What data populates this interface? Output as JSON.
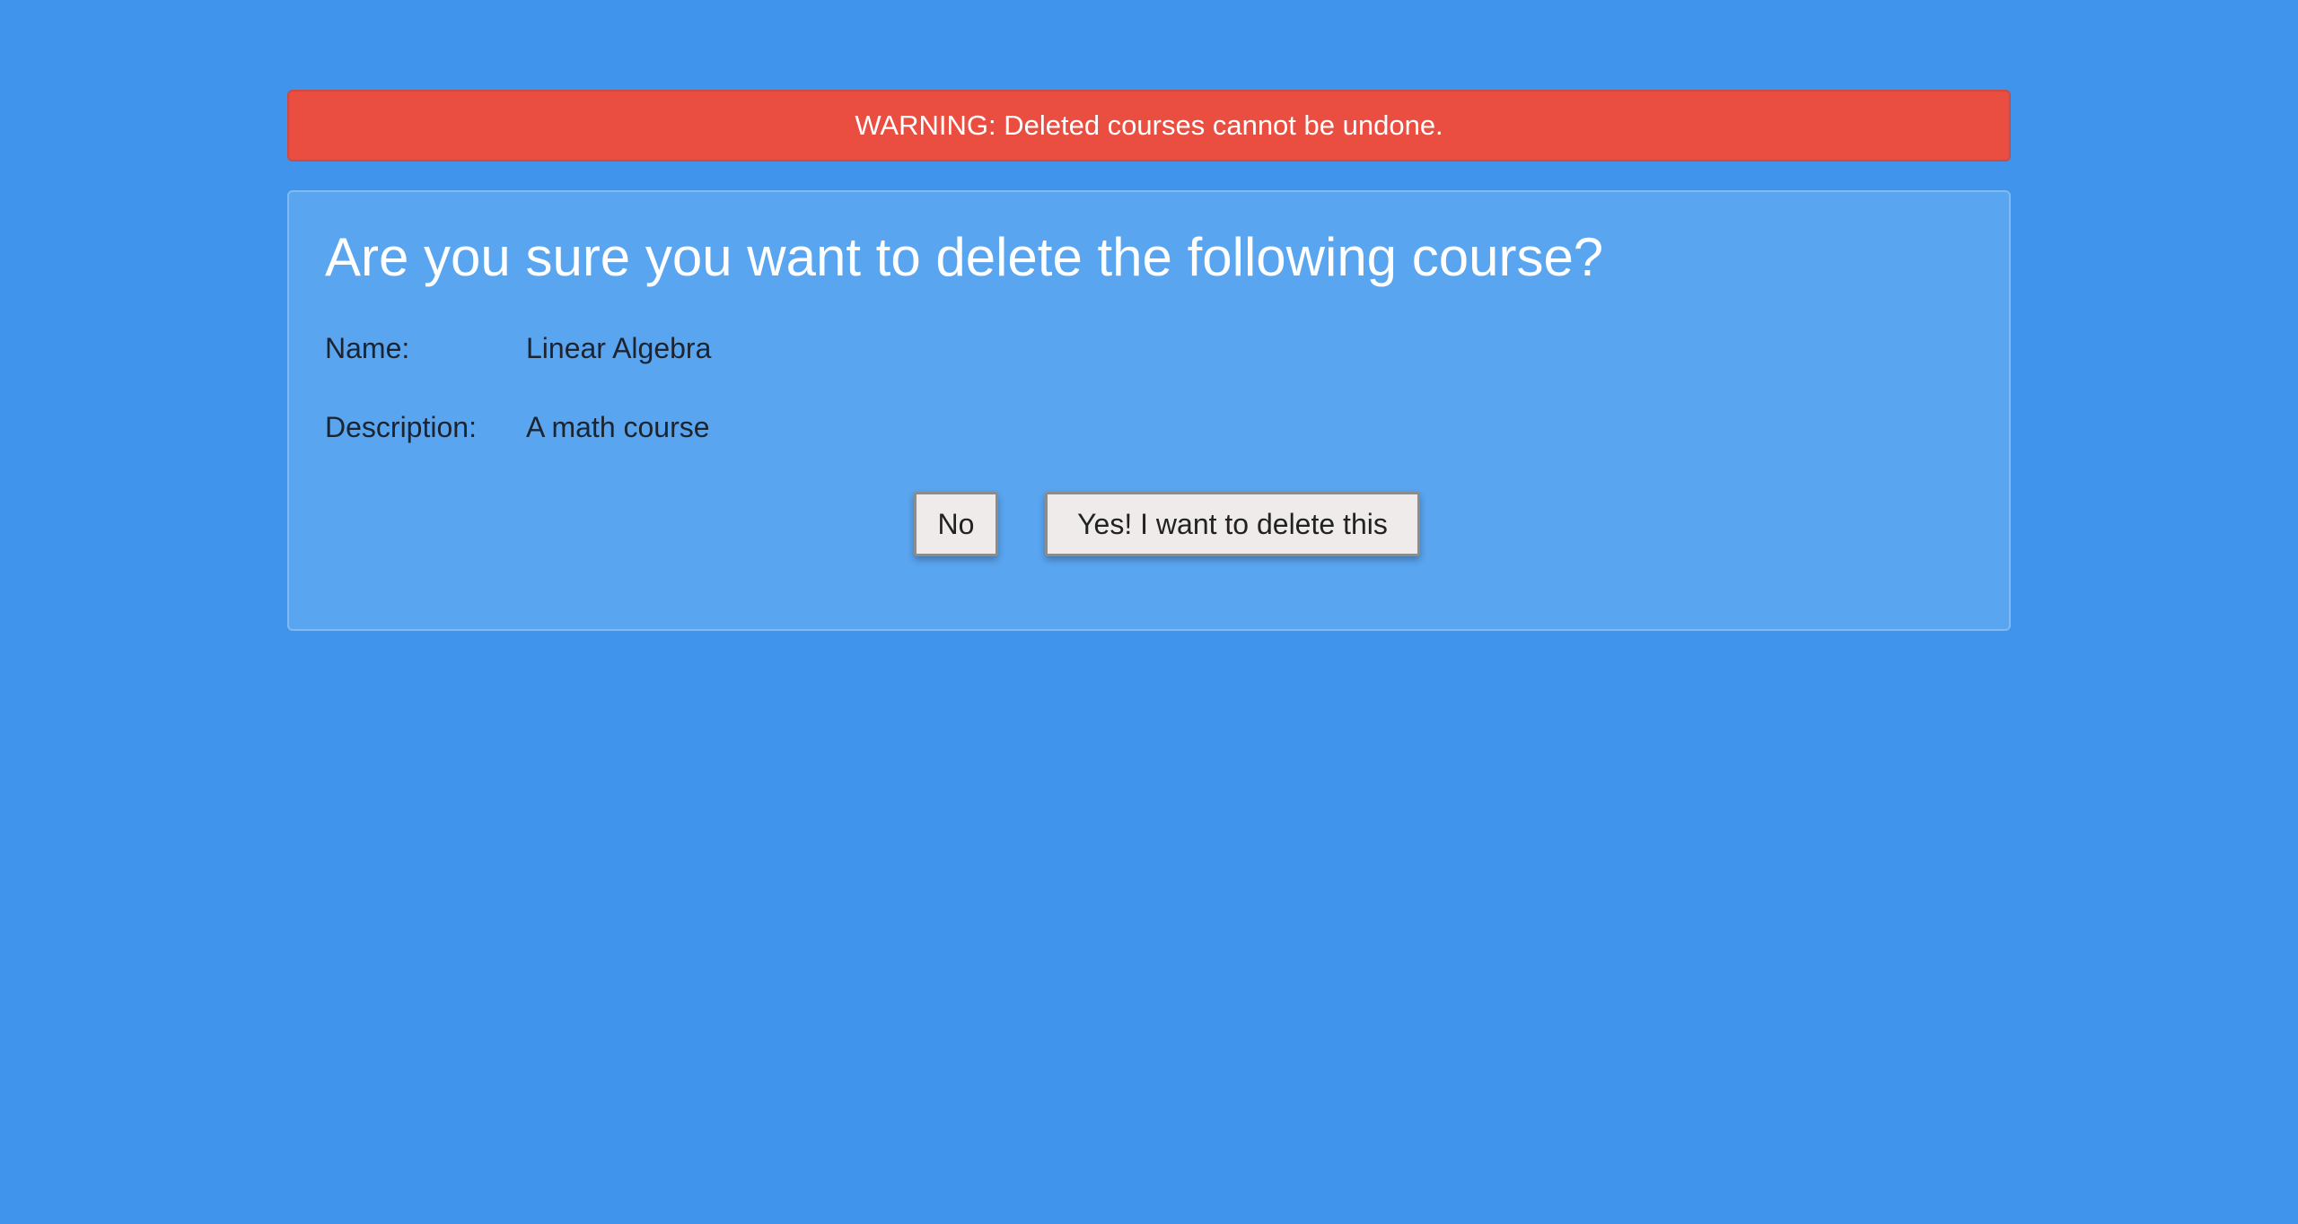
{
  "warning": {
    "text": "WARNING: Deleted courses cannot be undone."
  },
  "dialog": {
    "title": "Are you sure you want to delete the following course?",
    "fields": [
      {
        "label": "Name:",
        "value": "Linear Algebra"
      },
      {
        "label": "Description:",
        "value": "A math course"
      }
    ],
    "buttons": {
      "no_label": "No",
      "yes_label": "Yes! I want to delete this"
    }
  },
  "colors": {
    "background": "#4094ec",
    "warning_bg": "#e94e41",
    "panel_bg": "#5aa5f0"
  }
}
